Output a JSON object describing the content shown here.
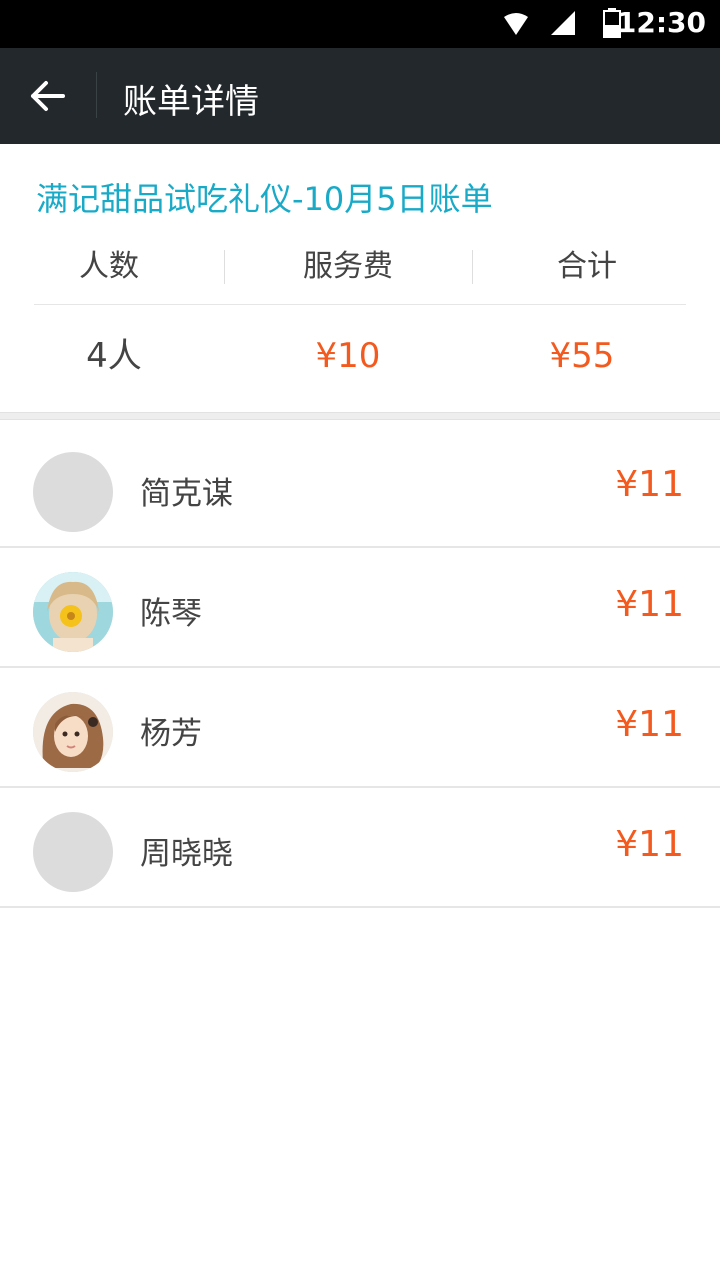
{
  "status_bar": {
    "time": "12:30",
    "icons": [
      "wifi-icon",
      "signal-icon",
      "battery-icon"
    ]
  },
  "toolbar": {
    "title": "账单详情",
    "back_icon": "arrow-left-icon"
  },
  "bill": {
    "title": "满记甜品试吃礼仪-10月5日账单",
    "headers": [
      "人数",
      "服务费",
      "合计"
    ],
    "values": {
      "people": "4人",
      "service_fee": "¥10",
      "total": "¥55"
    }
  },
  "members": [
    {
      "name": "简克谋",
      "amount": "¥11",
      "avatar": "placeholder"
    },
    {
      "name": "陈琴",
      "amount": "¥11",
      "avatar": "photo-girl-flower"
    },
    {
      "name": "杨芳",
      "amount": "¥11",
      "avatar": "photo-girl"
    },
    {
      "name": "周晓晓",
      "amount": "¥11",
      "avatar": "placeholder"
    }
  ],
  "colors": {
    "accent": "#19aac8",
    "price": "#f25a1f",
    "toolbar_bg": "#22282b"
  }
}
